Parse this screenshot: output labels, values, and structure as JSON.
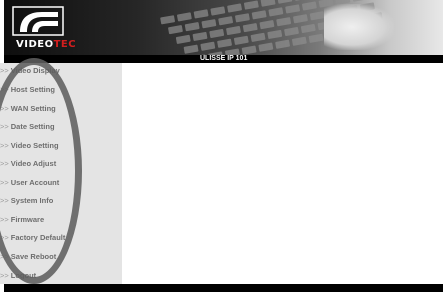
{
  "header": {
    "logo_text_main": "VIDEO",
    "logo_text_accent": "TEC",
    "title": "ULISSE IP 101"
  },
  "sidebar": {
    "items": [
      {
        "arrow": ">>",
        "label": "Video Display"
      },
      {
        "arrow": ">>",
        "label": "Host Setting"
      },
      {
        "arrow": ">>",
        "label": "WAN Setting"
      },
      {
        "arrow": ">>",
        "label": "Date Setting"
      },
      {
        "arrow": ">>",
        "label": "Video Setting"
      },
      {
        "arrow": ">>",
        "label": "Video Adjust"
      },
      {
        "arrow": ">>",
        "label": "User Account"
      },
      {
        "arrow": ">>",
        "label": "System Info"
      },
      {
        "arrow": ">>",
        "label": "Firmware"
      },
      {
        "arrow": ">>",
        "label": "Factory Default"
      },
      {
        "arrow": ">>",
        "label": "Save Reboot"
      },
      {
        "arrow": ">>",
        "label": "Logout"
      }
    ]
  },
  "colors": {
    "header_bar": "#000000",
    "sidebar_bg": "#e4e4e4",
    "logo_accent": "#d21e1e",
    "annotation_circle": "#5f5f5f"
  }
}
